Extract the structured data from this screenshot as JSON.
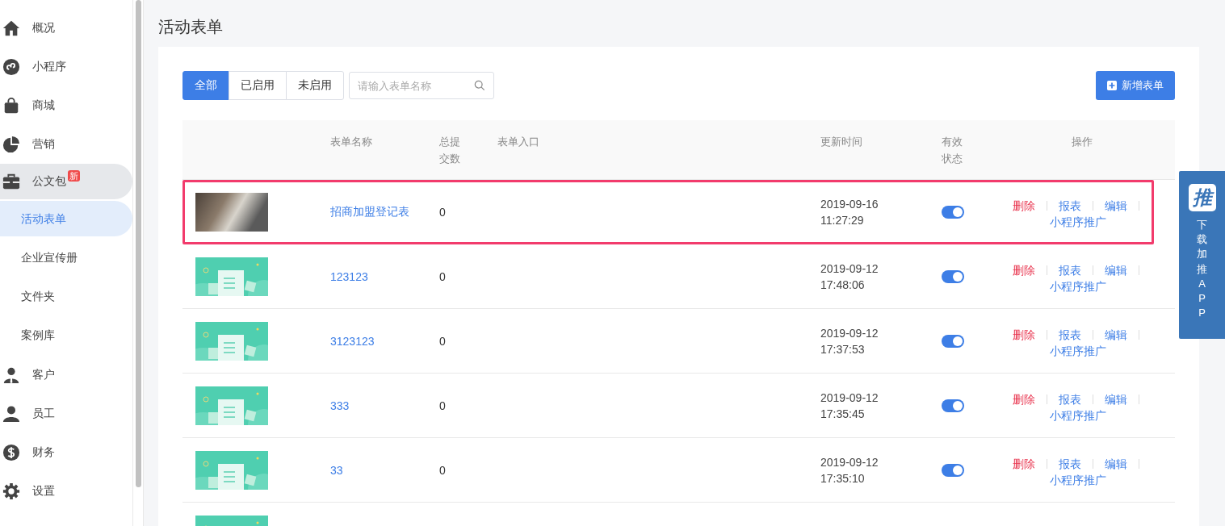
{
  "sidebar": {
    "items": [
      {
        "label": "概况",
        "expanded": false
      },
      {
        "label": "小程序",
        "expanded": false
      },
      {
        "label": "商城",
        "expanded": false
      },
      {
        "label": "营销",
        "expanded": false
      },
      {
        "label": "公文包",
        "badge": "新",
        "expanded": true,
        "children": [
          {
            "label": "活动表单",
            "selected": true
          },
          {
            "label": "企业宣传册",
            "selected": false
          },
          {
            "label": "文件夹",
            "selected": false
          },
          {
            "label": "案例库",
            "selected": false
          }
        ]
      },
      {
        "label": "客户",
        "expanded": false
      },
      {
        "label": "员工",
        "expanded": false
      },
      {
        "label": "财务",
        "expanded": false
      },
      {
        "label": "设置",
        "expanded": false
      }
    ]
  },
  "page_title": "活动表单",
  "filter_tabs": [
    {
      "label": "全部",
      "selected": true
    },
    {
      "label": "已启用",
      "selected": false
    },
    {
      "label": "未启用",
      "selected": false
    }
  ],
  "search": {
    "placeholder": "请输入表单名称"
  },
  "add_button": "新增表单",
  "table": {
    "columns": [
      "",
      "表单名称",
      "总提交数",
      "表单入口",
      "更新时间",
      "有效状态",
      "操作"
    ],
    "rows": [
      {
        "kind": "photo",
        "name": "招商加盟登记表",
        "count": "0",
        "date": "2019-09-16",
        "time": "11:27:29",
        "on": true,
        "highlighted": true,
        "actions": [
          "删除",
          "报表",
          "编辑",
          "小程序推广"
        ]
      },
      {
        "kind": "illustration",
        "name": "123123",
        "count": "0",
        "date": "2019-09-12",
        "time": "17:48:06",
        "on": true,
        "highlighted": false,
        "actions": [
          "删除",
          "报表",
          "编辑",
          "小程序推广"
        ]
      },
      {
        "kind": "illustration",
        "name": "3123123",
        "count": "0",
        "date": "2019-09-12",
        "time": "17:37:53",
        "on": true,
        "highlighted": false,
        "actions": [
          "删除",
          "报表",
          "编辑",
          "小程序推广"
        ]
      },
      {
        "kind": "illustration",
        "name": "333",
        "count": "0",
        "date": "2019-09-12",
        "time": "17:35:45",
        "on": true,
        "highlighted": false,
        "actions": [
          "删除",
          "报表",
          "编辑",
          "小程序推广"
        ]
      },
      {
        "kind": "illustration",
        "name": "33",
        "count": "0",
        "date": "2019-09-12",
        "time": "17:35:10",
        "on": true,
        "highlighted": false,
        "actions": [
          "删除",
          "报表",
          "编辑",
          "小程序推广"
        ]
      },
      {
        "kind": "illustration",
        "highlighted": false
      }
    ]
  },
  "side_panel": {
    "logo": "推",
    "text": "下载加推APP"
  }
}
